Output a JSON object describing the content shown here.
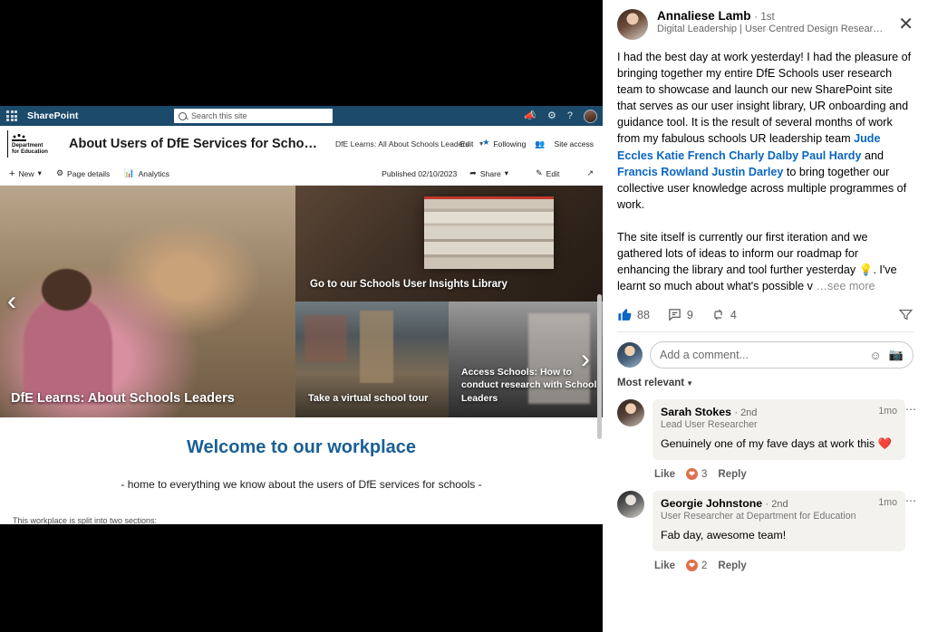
{
  "sharepoint": {
    "suite": {
      "app_name": "SharePoint",
      "search_placeholder": "Search this site",
      "icons": [
        "waffle-icon",
        "feedback-megaphone-icon",
        "gear-icon",
        "help-icon",
        "user-avatar"
      ]
    },
    "site": {
      "logo_line1": "Department",
      "logo_line2": "for Education",
      "title": "About Users of DfE Services for Scho…",
      "nav_item": "DfE Learns: All About Schools Leaders",
      "nav_more": "…",
      "edit_label": "Edit",
      "following_label": "Following",
      "site_access_label": "Site access"
    },
    "command_bar": {
      "new_label": "New",
      "page_details_label": "Page details",
      "analytics_label": "Analytics",
      "published_label": "Published 02/10/2023",
      "share_label": "Share",
      "edit_label": "Edit"
    },
    "hero": {
      "main_caption": "DfE Learns: About Schools Leaders",
      "tile_top_caption": "Go to our Schools User Insights Library",
      "tile_bottom_left_caption": "Take a virtual school tour",
      "tile_bottom_right_caption": "Access Schools: How to conduct research with School Leaders",
      "prev_label": "‹",
      "next_label": "›"
    },
    "welcome": {
      "heading": "Welcome to our workplace",
      "subheading": "- home to everything we know about the users of DfE services for schools -",
      "note": "This workplace is split into two sections:"
    }
  },
  "linkedin": {
    "author": {
      "name": "Annaliese Lamb",
      "degree": "· 1st",
      "headline": "Digital Leadership | User Centred Design Resear…"
    },
    "close_label": "✕",
    "post": {
      "p1_a": "I had the best day at work yesterday! I had the pleasure of bringing together my entire DfE Schools user research team to showcase and launch our new SharePoint site that serves as our user insight library, UR onboarding and guidance tool. It is the result of several months of work from my fabulous schools UR leadership team ",
      "mention1": "Jude Eccles Katie French Charly Dalby Paul Hardy",
      "p1_b": " and ",
      "mention2": "Francis Rowland Justin Darley",
      "p1_c": " to bring together our collective user knowledge across multiple programmes of work.",
      "p2": "The site itself is currently our first iteration and we gathered lots of ideas to inform our roadmap for enhancing the library and tool further yesterday 💡. I've learnt so much about what's possible v",
      "see_more": "…see more"
    },
    "social": {
      "likes": "88",
      "comments": "9",
      "reposts": "4"
    },
    "comment_box": {
      "placeholder": "Add a comment...",
      "emoji_icon": "emoji-icon",
      "image_icon": "image-icon"
    },
    "sort": {
      "label": "Most relevant"
    },
    "comments": [
      {
        "name": "Sarah Stokes",
        "degree": "· 2nd",
        "title": "Lead User Researcher",
        "time": "1mo",
        "text": "Genuinely one of my fave days at work this ❤️",
        "like_label": "Like",
        "reaction_count": "3",
        "reply_label": "Reply"
      },
      {
        "name": "Georgie Johnstone",
        "degree": "· 2nd",
        "title": "User Researcher at Department for Education",
        "time": "1mo",
        "text": "Fab day, awesome team!",
        "like_label": "Like",
        "reaction_count": "2",
        "reply_label": "Reply"
      }
    ]
  },
  "colors": {
    "sharepoint_bar": "#1b4a6b",
    "linkedin_blue": "#0a66c2",
    "heading_blue": "#1a6094"
  }
}
